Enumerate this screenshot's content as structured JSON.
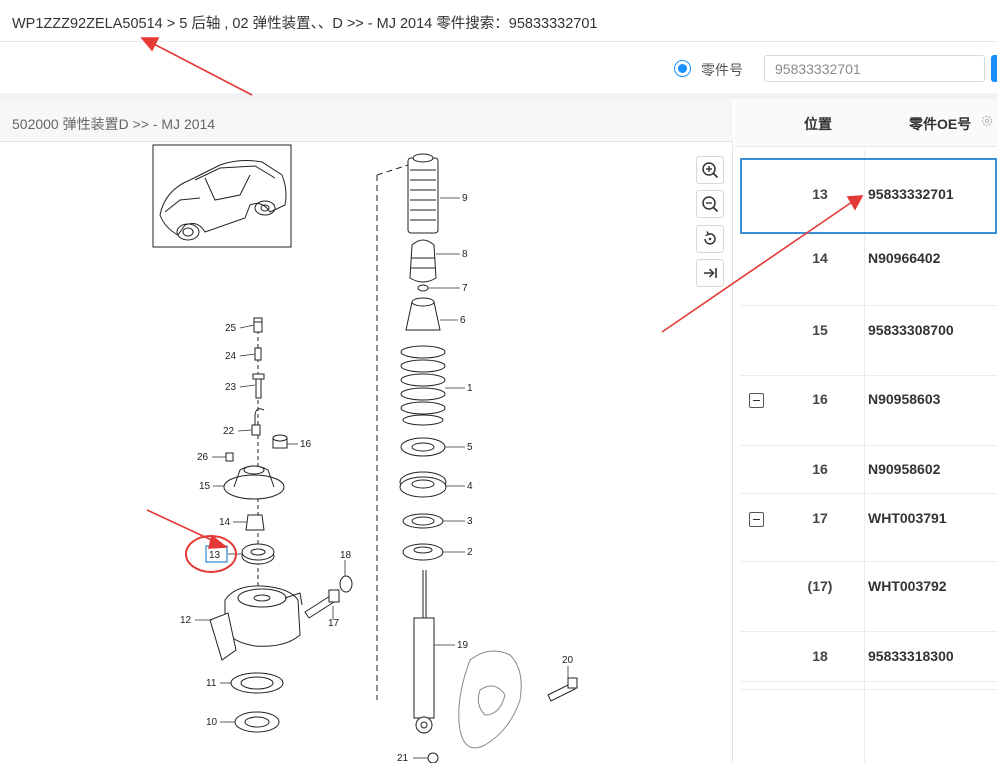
{
  "breadcrumb": "WP1ZZZ92ZELA50514 > 5 后轴 , 02 弹性装置、、D >> - MJ 2014 零件搜索：95833332701",
  "search": {
    "radio_label": "零件号",
    "value": "95833332701"
  },
  "panel": {
    "title": "502000 弹性装置D >> - MJ 2014"
  },
  "toolbar": {
    "zoom_in": "zoom-in-icon",
    "zoom_out": "zoom-out-icon",
    "reset": "reset-icon",
    "collapse": "collapse-right-icon"
  },
  "diagram": {
    "callouts": [
      "25",
      "24",
      "23",
      "22",
      "26",
      "16",
      "15",
      "14",
      "13",
      "12",
      "18",
      "17",
      "11",
      "10",
      "9",
      "8",
      "7",
      "6",
      "1",
      "5",
      "4",
      "3",
      "2",
      "19",
      "20",
      "21"
    ],
    "highlight": "13"
  },
  "table": {
    "headers": [
      "位置",
      "零件OE号"
    ],
    "rows": [
      {
        "pos": "13",
        "oe": "95833332701",
        "expander": false,
        "selected": true
      },
      {
        "pos": "14",
        "oe": "N90966402",
        "expander": false,
        "selected": false
      },
      {
        "pos": "15",
        "oe": "95833308700",
        "expander": false,
        "selected": false
      },
      {
        "pos": "16",
        "oe": "N90958603",
        "expander": true,
        "selected": false
      },
      {
        "pos": "16",
        "oe": "N90958602",
        "expander": false,
        "selected": false
      },
      {
        "pos": "17",
        "oe": "WHT003791",
        "expander": true,
        "selected": false
      },
      {
        "pos": "(17)",
        "oe": "WHT003792",
        "expander": false,
        "selected": false
      },
      {
        "pos": "18",
        "oe": "95833318300",
        "expander": false,
        "selected": false
      }
    ]
  },
  "colors": {
    "accent": "#1890ff",
    "selected_border": "#3c8fd4",
    "annotation_red": "#e53935"
  }
}
